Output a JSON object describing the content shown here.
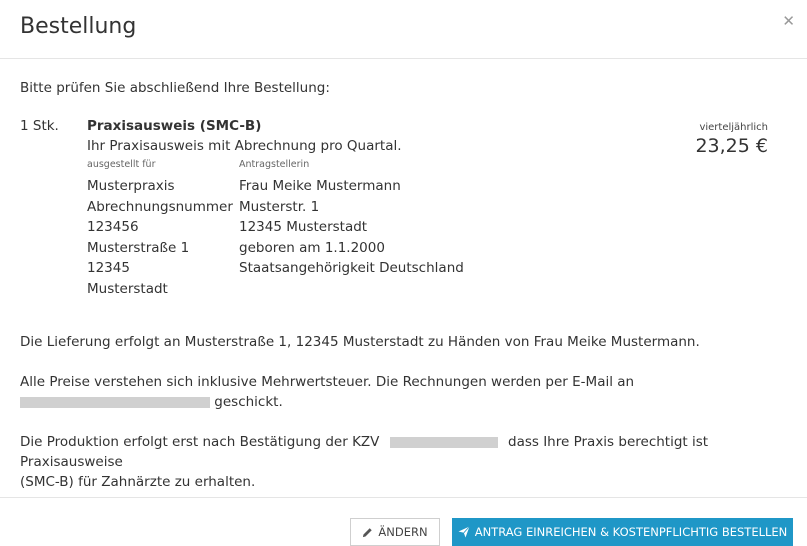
{
  "modal": {
    "title": "Bestellung",
    "close_icon": "close-icon"
  },
  "body": {
    "intro": "Bitte prüfen Sie abschließend Ihre Bestellung:",
    "item": {
      "quantity": "1 Stk.",
      "name": "Praxisausweis (SMC-B)",
      "description": "Ihr Praxisausweis mit Abrechnung pro Quartal.",
      "issued_for_label": "ausgestellt für",
      "issued_for_lines": [
        "Musterpraxis",
        "Abrechnungsnummer",
        "123456",
        "Musterstraße 1",
        "12345",
        "Musterstadt"
      ],
      "applicant_label": "Antragstellerin",
      "applicant_lines": [
        "Frau Meike Mustermann",
        "Musterstr. 1",
        "12345 Musterstadt",
        "geboren am 1.1.2000",
        "Staatsangehörigkeit Deutschland"
      ],
      "price_period": "vierteljährlich",
      "price": "23,25 €"
    },
    "delivery": "Die Lieferung erfolgt an Musterstraße 1, 12345 Musterstadt zu Händen von Frau Meike Mustermann.",
    "prices_line1": "Alle Preise verstehen sich inklusive Mehrwertsteuer. Die Rechnungen werden per E-Mail an",
    "prices_line2": "geschickt.",
    "production_part1": "Die Produktion erfolgt erst nach Bestätigung der KZV",
    "production_part2": "dass Ihre Praxis berechtigt ist Praxisausweise",
    "production_line2": "(SMC-B) für Zahnärzte zu erhalten."
  },
  "footer": {
    "edit_label": "ÄNDERN",
    "edit_icon": "pencil-icon",
    "submit_label": "ANTRAG EINREICHEN & KOSTENPFLICHTIG BESTELLEN",
    "submit_icon": "paper-plane-icon",
    "accent": "#1f97c7"
  }
}
